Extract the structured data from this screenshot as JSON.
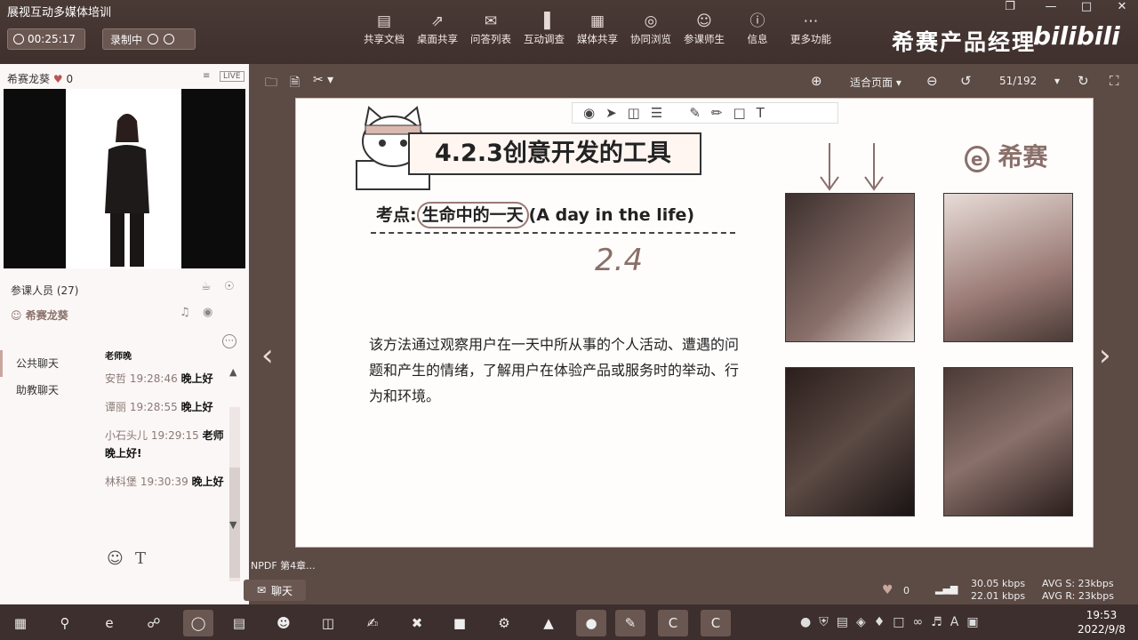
{
  "app": {
    "title": "展视互动多媒体培训",
    "window_controls": [
      "❐",
      "—",
      "□",
      "✕"
    ],
    "timer": "00:25:17",
    "recording": "录制中"
  },
  "toolbar": [
    {
      "label": "共享文档",
      "icon": "document-icon",
      "g": "▤"
    },
    {
      "label": "桌面共享",
      "icon": "desktop-share-icon",
      "g": "⇗"
    },
    {
      "label": "问答列表",
      "icon": "qa-icon",
      "g": "✉"
    },
    {
      "label": "互动调查",
      "icon": "survey-icon",
      "g": "▐"
    },
    {
      "label": "媒体共享",
      "icon": "media-icon",
      "g": "▦"
    },
    {
      "label": "协同浏览",
      "icon": "browse-icon",
      "g": "◎"
    },
    {
      "label": "参课师生",
      "icon": "participants-icon",
      "g": "☺"
    },
    {
      "label": "信息",
      "icon": "info-icon",
      "g": "ⓘ"
    },
    {
      "label": "更多功能",
      "icon": "more-icon",
      "g": "⋯"
    }
  ],
  "brand": "希赛产品经理",
  "bili": "bilibili",
  "presenter": {
    "name": "希赛龙葵",
    "likes": "0",
    "live": "LIVE"
  },
  "participants": {
    "label": "参课人员 (27)",
    "current": "希赛龙葵"
  },
  "chat": {
    "tabs": [
      "公共聊天",
      "助教聊天"
    ],
    "partial": "老师晚",
    "messages": [
      {
        "name": "安哲",
        "time": "19:28:46",
        "text": "晚上好"
      },
      {
        "name": "谭丽",
        "time": "19:28:55",
        "text": "晚上好"
      },
      {
        "name": "小石头儿",
        "time": "19:29:15",
        "text": "老师晚上好!"
      },
      {
        "name": "林科堡",
        "time": "19:30:39",
        "text": "晚上好"
      }
    ],
    "chat_button": "聊天"
  },
  "viewer": {
    "fit": "适合页面",
    "page": "51/192",
    "file": "NPDF 第4章..."
  },
  "slide": {
    "heading": "4.2.3创意开发的工具",
    "logo": "希赛",
    "key_label": "考点:",
    "key_value": "生命中的一天",
    "key_en": "(A day in the life)",
    "annotation": "2.4",
    "body": "该方法通过观察用户在一天中所从事的个人活动、遭遇的问题和产生的情绪，了解用户在体验产品或服务时的举动、行为和环境。"
  },
  "status": {
    "likes": "0",
    "up": "30.05 kbps",
    "down": "22.01 kbps",
    "avg_s": "AVG S: 23kbps",
    "avg_r": "AVG R: 23kbps"
  },
  "clock": {
    "time": "19:53",
    "date": "2022/9/8"
  }
}
